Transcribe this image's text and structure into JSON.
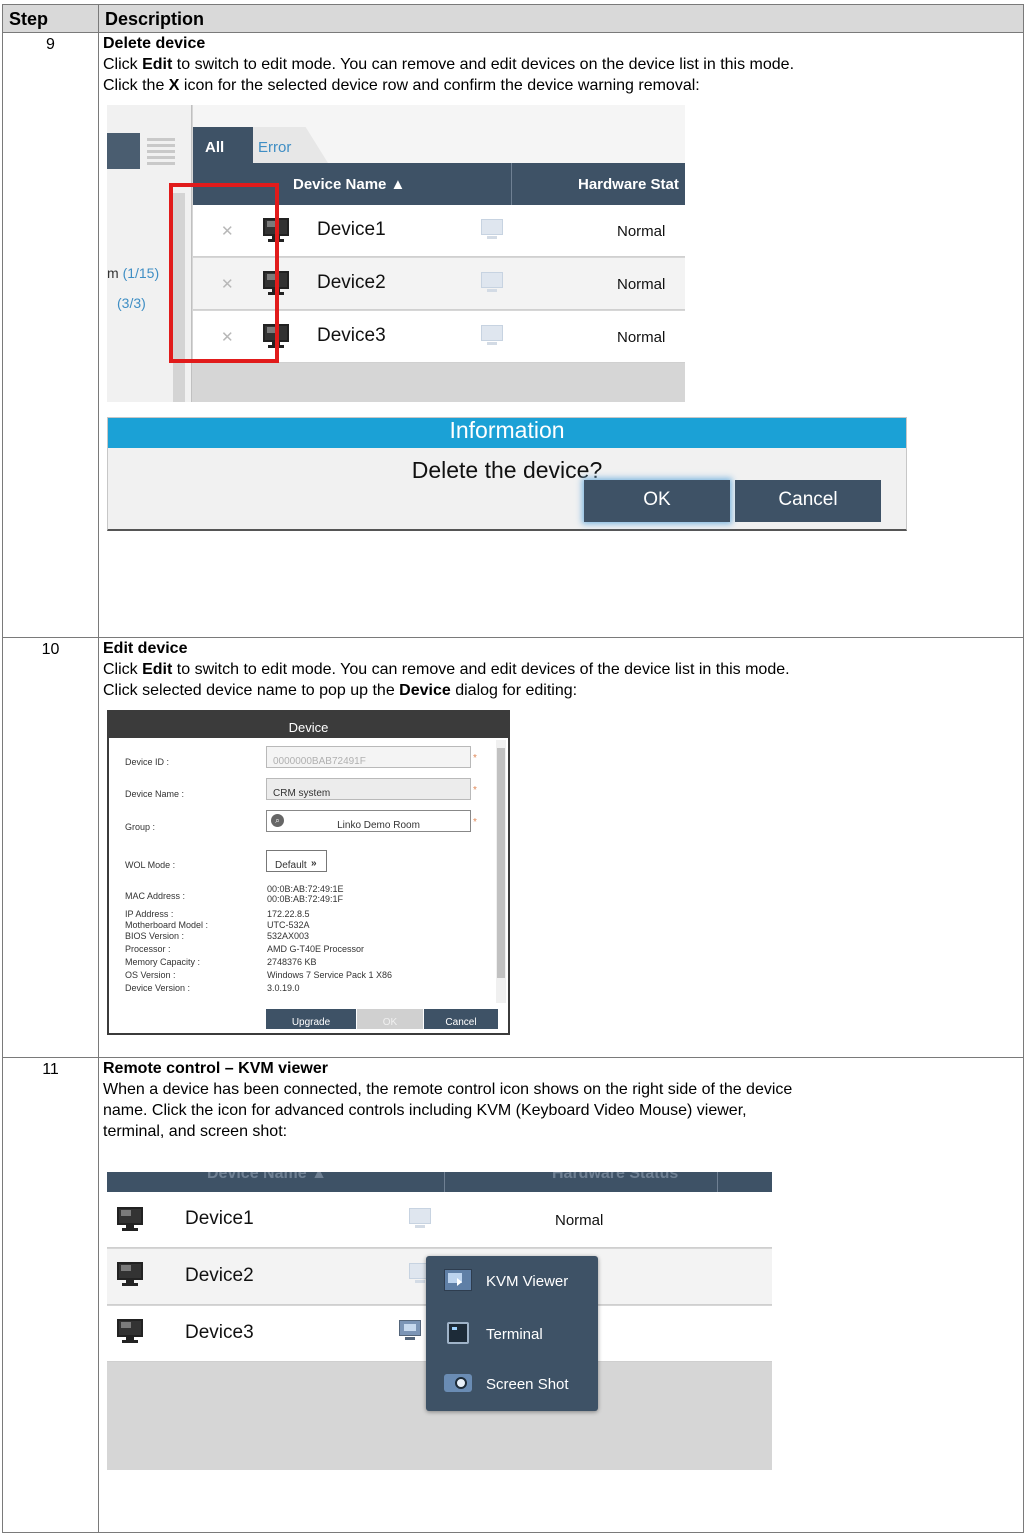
{
  "table": {
    "header_step": "Step",
    "header_description": "Description"
  },
  "steps": [
    {
      "number": "9",
      "title": "Delete device",
      "desc": {
        "p1_before": "Click ",
        "p1_bold": "Edit",
        "p1_after": " to switch to edit mode. You can remove and edit devices on the device list in this mode.",
        "p2_before": "Click the ",
        "p2_bold": "X",
        "p2_after": " icon for the selected device row and confirm the device warning removal:"
      },
      "screenshot": {
        "tab_all": "All",
        "tab_error": "Error",
        "col_name": "Device Name ▲",
        "col_status": "Hardware Stat",
        "side_1_label": "m ",
        "side_1_value": "(1/15)",
        "side_2_value": "(3/3)",
        "rows": [
          {
            "name": "Device1",
            "status": "Normal"
          },
          {
            "name": "Device2",
            "status": "Normal"
          },
          {
            "name": "Device3",
            "status": "Normal"
          }
        ]
      },
      "dialog": {
        "title": "Information",
        "message": "Delete the device?",
        "ok": "OK",
        "cancel": "Cancel"
      }
    },
    {
      "number": "10",
      "title": "Edit device",
      "desc": {
        "p1_before": "Click ",
        "p1_bold": "Edit",
        "p1_after": " to switch to edit mode. You can remove and edit devices of the device list in this mode.",
        "p2_before": "Click selected device name to pop up the ",
        "p2_bold": "Device",
        "p2_after": " dialog for editing:"
      },
      "dialog": {
        "title": "Device",
        "device_id_label": "Device ID :",
        "device_id_value": "0000000BAB72491F",
        "device_name_label": "Device Name :",
        "device_name_value": "CRM system",
        "group_label": "Group :",
        "group_value": "Linko Demo Room",
        "wol_label": "WOL Mode :",
        "wol_value": "Default",
        "mac_label": "MAC Address :",
        "mac_value_1": "00:0B:AB:72:49:1E",
        "mac_value_2": "00:0B:AB:72:49:1F",
        "ip_label": "IP Address :",
        "ip_value": "172.22.8.5",
        "mb_label": "Motherboard Model :",
        "mb_value": "UTC-532A",
        "bios_label": "BIOS Version :",
        "bios_value": "532AX003",
        "proc_label": "Processor :",
        "proc_value": "AMD G-T40E Processor",
        "mem_label": "Memory Capacity :",
        "mem_value": "2748376 KB",
        "os_label": "OS Version :",
        "os_value": "Windows 7 Service Pack 1 X86",
        "devver_label": "Device Version :",
        "devver_value": "3.0.19.0",
        "upgrade": "Upgrade",
        "ok": "OK",
        "cancel": "Cancel",
        "required_mark": "*"
      }
    },
    {
      "number": "11",
      "title": "Remote control – KVM viewer",
      "desc": {
        "p1": "When a device has been connected, the remote control icon shows on the right side of the device",
        "p2": "name. Click the icon for advanced controls including KVM (Keyboard Video Mouse) viewer,",
        "p3": "terminal, and screen shot:"
      },
      "screenshot": {
        "col_name": "Device Name ▲",
        "col_status": "Hardware Status",
        "rows": [
          {
            "name": "Device1",
            "status": "Normal"
          },
          {
            "name": "Device2",
            "status": ""
          },
          {
            "name": "Device3",
            "status": ""
          }
        ],
        "menu": [
          "KVM Viewer",
          "Terminal",
          "Screen Shot"
        ]
      }
    }
  ],
  "colors": {
    "header_bg": "#d9d9d9",
    "dark_slate": "#3e5266",
    "info_blue": "#1ba1d6",
    "highlight_red": "#e11b1b",
    "link_blue": "#3f8ec4"
  },
  "icons": [
    "close-x-icon",
    "monitor-icon",
    "remote-control-icon",
    "list-view-icon",
    "search-icon",
    "double-chevron-down-icon",
    "kvm-viewer-icon",
    "terminal-icon",
    "camera-icon"
  ]
}
